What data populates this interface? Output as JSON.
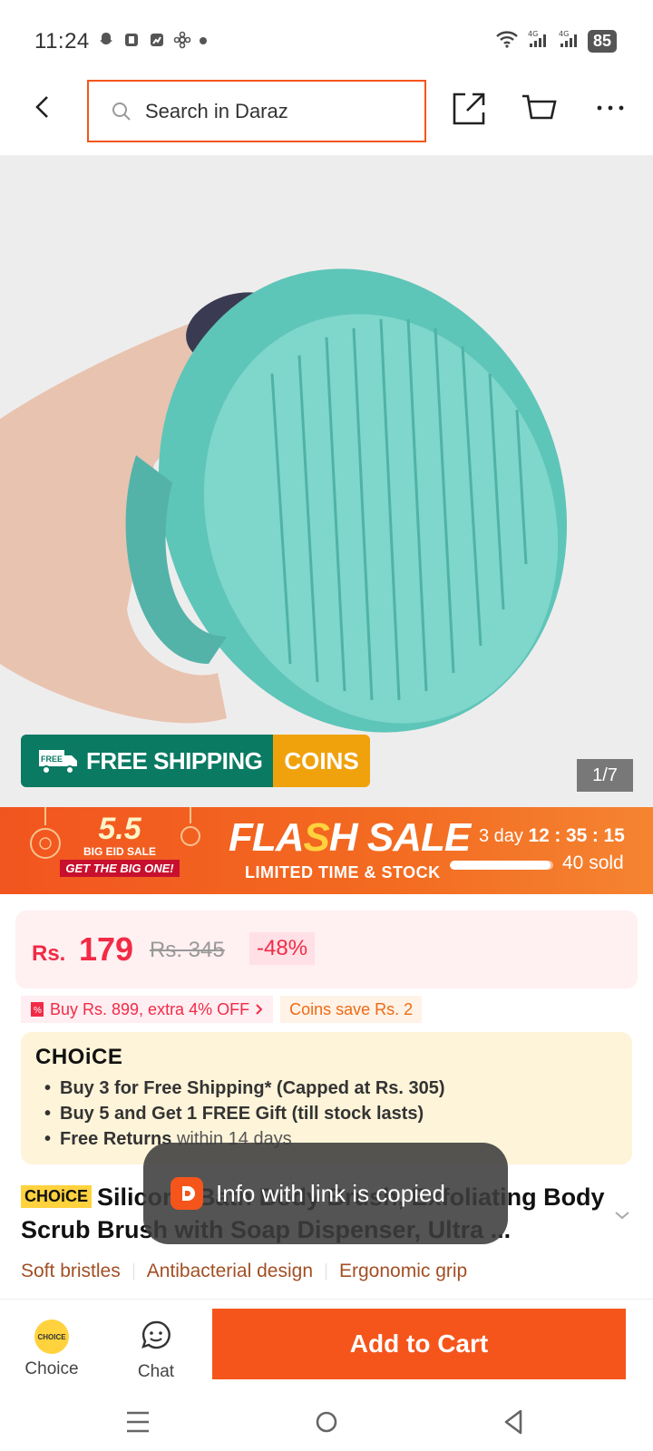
{
  "status_bar": {
    "time": "11:24",
    "battery": "85"
  },
  "header": {
    "search_placeholder": "Search in Daraz"
  },
  "product_image": {
    "free_shipping_label": "FREE SHIPPING",
    "free_tag": "FREE",
    "coins_label": "COINS",
    "counter": "1/7"
  },
  "flash_sale": {
    "eid_number": "5.5",
    "eid_line1": "BIG EID SALE",
    "eid_line2": "GET THE BIG ONE!",
    "title_part1": "FLA",
    "title_bolt": "S",
    "title_part2": "H SALE",
    "subtitle": "LIMITED TIME & STOCK",
    "countdown_days": "3 day",
    "countdown_h": "12",
    "countdown_m": "35",
    "countdown_s": "15",
    "sold_text": "40 sold",
    "sold_fraction": 0.97
  },
  "price": {
    "currency": "Rs.",
    "value": "179",
    "original": "Rs. 345",
    "discount": "-48%"
  },
  "promos": {
    "buy_more": "Buy Rs. 899, extra 4% OFF",
    "coins": "Coins save Rs. 2"
  },
  "choice": {
    "logo": "CHOiCE",
    "items": [
      {
        "bold": "Buy 3 for  Free Shipping* (Capped at Rs. 305)",
        "light": ""
      },
      {
        "bold": "Buy 5 and Get 1 FREE Gift (till stock lasts)",
        "light": ""
      },
      {
        "bold": "Free Returns",
        "light": " within 14 days"
      }
    ]
  },
  "title": {
    "badge": "CHOiCE",
    "text": "Silicone Bath Body Brush, Exfoliating Body Scrub Brush with Soap Dispenser, Ultra ..."
  },
  "features": [
    "Soft bristles",
    "Antibacterial design",
    "Ergonomic grip"
  ],
  "toast": {
    "text": "Info with link is copied"
  },
  "bottom_bar": {
    "choice_label": "Choice",
    "choice_coin": "CHOICE",
    "chat_label": "Chat",
    "add_to_cart": "Add to Cart"
  },
  "colors": {
    "brand_orange": "#f5551b",
    "price_red": "#f12b46",
    "free_ship_green": "#0a7a63",
    "coins_gold": "#f0a20c",
    "choice_bg": "#fef4d9"
  }
}
